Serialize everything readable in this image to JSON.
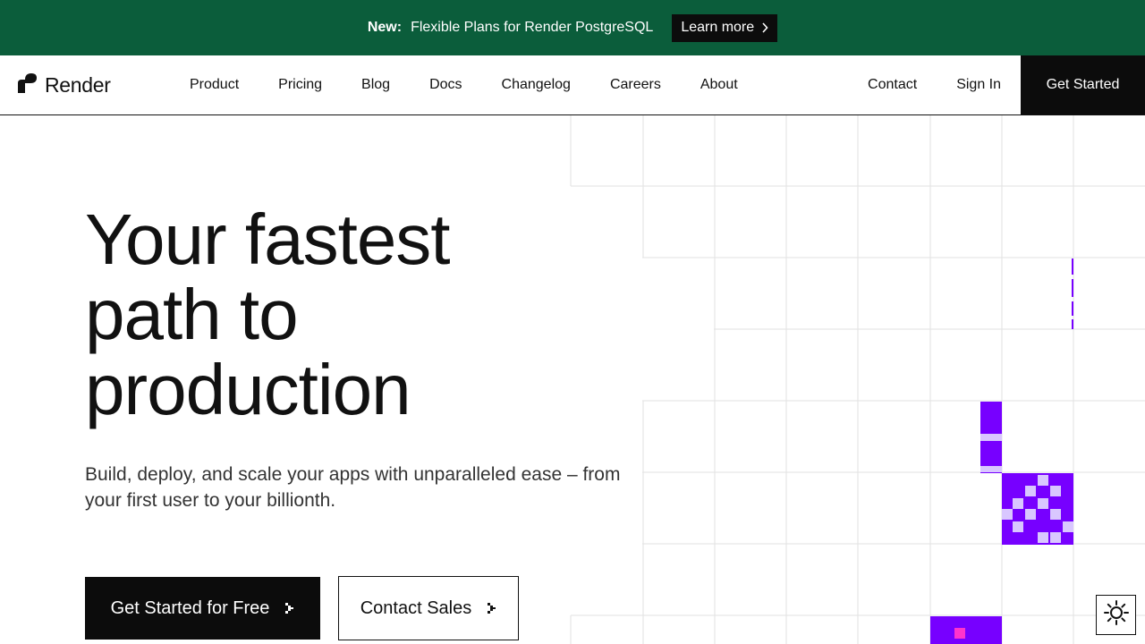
{
  "banner": {
    "badge": "New:",
    "text": "Flexible Plans for Render PostgreSQL",
    "cta": "Learn more",
    "background": "#0b5d3b"
  },
  "nav": {
    "logo_text": "Render",
    "links": [
      "Product",
      "Pricing",
      "Blog",
      "Docs",
      "Changelog",
      "Careers",
      "About"
    ],
    "contact": "Contact",
    "sign_in": "Sign In",
    "get_started": "Get Started"
  },
  "hero": {
    "title_lines": [
      "Your fastest",
      "path to",
      "production"
    ],
    "subtitle": "Build, deploy, and scale your apps with unparalleled ease – from your first user to your billionth.",
    "primary_cta": "Get Started for Free",
    "secondary_cta": "Contact Sales"
  },
  "colors": {
    "accent": "#7700ff",
    "accent_light": "#d9c7ff",
    "magenta": "#ff33cc",
    "grid_line": "#e2e2e2"
  },
  "icons": {
    "logo": "render-logo-icon",
    "chevron": "chevron-right-icon",
    "theme": "sun-icon"
  }
}
